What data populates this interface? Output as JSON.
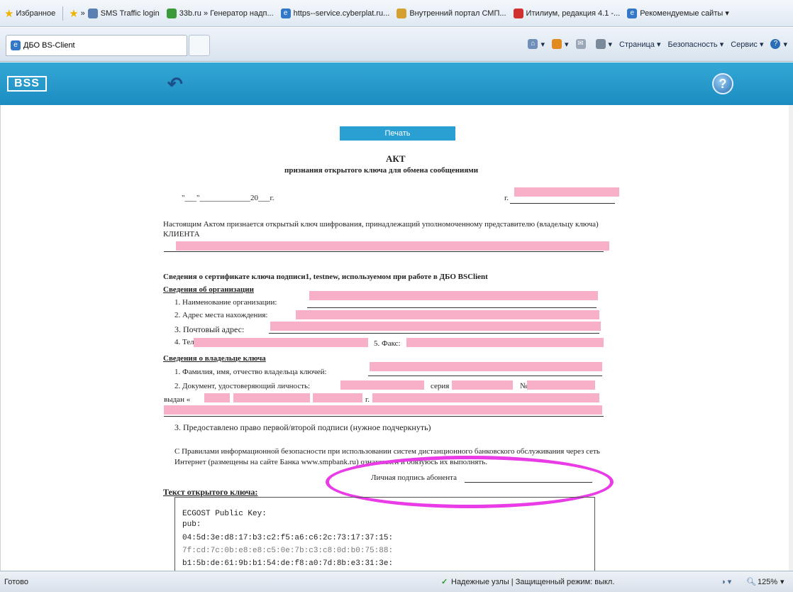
{
  "favorites": {
    "label": "Избранное",
    "items": [
      {
        "label": "SMS Traffic login"
      },
      {
        "label": "33b.ru » Генератор надп..."
      },
      {
        "label": "https--service.cyberplat.ru..."
      },
      {
        "label": "Внутренний портал СМП..."
      },
      {
        "label": "Итилиум, редакция 4.1 -..."
      },
      {
        "label": "Рекомендуемые сайты ▾"
      }
    ]
  },
  "tab": {
    "title": "ДБО BS-Client"
  },
  "commands": {
    "page": "Страница ▾",
    "security": "Безопасность ▾",
    "service": "Сервис ▾"
  },
  "app": {
    "logo": "BSS"
  },
  "document": {
    "print_label": "Печать",
    "title": "АКТ",
    "subtitle": "признания открытого ключа для обмена сообщениями",
    "date_line": "\"___\"_____________20___г.",
    "city_label": "г.",
    "intro": "Настоящим Актом признается открытый ключ шифрования, принадлежащий уполномоченному представителю (владельцу ключа)",
    "client": "КЛИЕНТА",
    "cert_heading": "Сведения о сертификате ключа подписи1, testnew, используемом при работе в ДБО BSClient",
    "org_heading": "Сведения об организации",
    "org_items": [
      "1.  Наименование организации:",
      "2.  Адрес места нахождения:",
      "3.  Почтовый адрес:",
      "4.  Тел."
    ],
    "fax_label": "5. Факс:",
    "owner_heading": "Сведения о владельце ключа",
    "owner_items": [
      "1.  Фамилия, имя, отчество владельца ключей:",
      "2.  Документ, удостоверяющий личность:"
    ],
    "series_label": "серия",
    "number_label": "№",
    "issued_label": "выдан «",
    "year_label": "г.",
    "signature_right": "3.  Предоставлено право первой/второй подписи (нужное подчеркнуть)",
    "rules_line1": "С Правилами информационной безопасности при использовании систем дистанционного банковского обслуживания через сеть",
    "rules_line2": "Интернет (размещены на сайте Банка www.smpbank.ru) ознакомлен и обязуюсь их выполнять.",
    "signature_label": "Личная подпись абонента",
    "key_heading": "Текст открытого ключа:",
    "key_lines": [
      "ECGOST Public Key:",
      "pub:",
      "    04:5d:3e:d8:17:b3:c2:f5:a6:c6:2c:73:17:37:15:",
      "    7f:cd:7c:0b:e8:e8:c5:0e:7b:c3:c8:0d:b0:75:88:",
      "    b1:5b:de:61:9b:b1:54:de:f8:a0:7d:8b:e3:31:3e:"
    ]
  },
  "status": {
    "left": "Готово",
    "zone": "Надежные узлы | Защищенный режим: выкл.",
    "zoom": "125%"
  }
}
